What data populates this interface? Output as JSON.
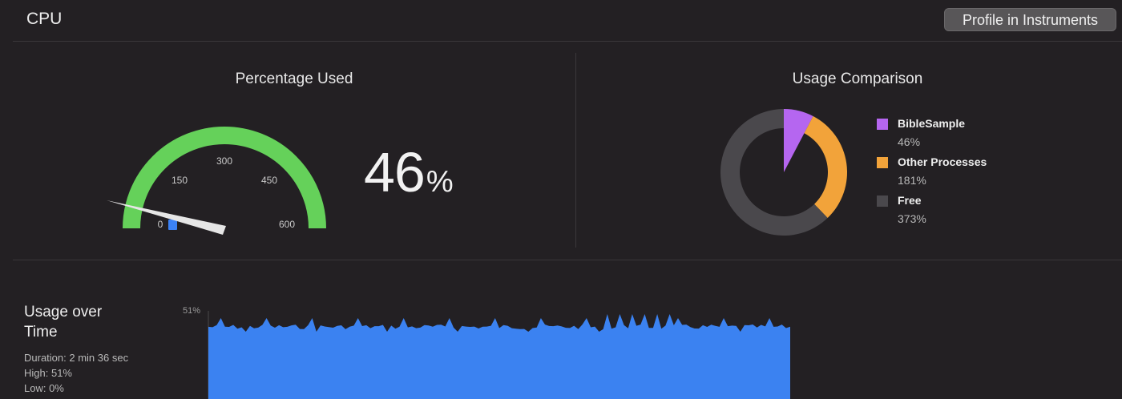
{
  "header": {
    "title": "CPU",
    "profile_button": "Profile in Instruments"
  },
  "percentage_used": {
    "title": "Percentage Used",
    "value": 46,
    "value_text": "46",
    "unit": "%",
    "gauge": {
      "max": 600,
      "ticks": [
        "0",
        "150",
        "300",
        "450",
        "600"
      ],
      "arc_color": "#65d15a",
      "needle_color": "#e6e6e6",
      "marker_color": "#3b82f6"
    }
  },
  "usage_comparison": {
    "title": "Usage Comparison",
    "items": [
      {
        "name": "BibleSample",
        "value_text": "46%",
        "value": 46,
        "color": "#b566f0"
      },
      {
        "name": "Other Processes",
        "value_text": "181%",
        "value": 181,
        "color": "#f2a33a"
      },
      {
        "name": "Free",
        "value_text": "373%",
        "value": 373,
        "color": "#4a484c"
      }
    ]
  },
  "usage_over_time": {
    "title": "Usage over Time",
    "duration": "Duration: 2 min 36 sec",
    "high": "High: 51%",
    "low": "Low: 0%",
    "y_max_label": "51%",
    "fill_color": "#3b82f1"
  }
}
